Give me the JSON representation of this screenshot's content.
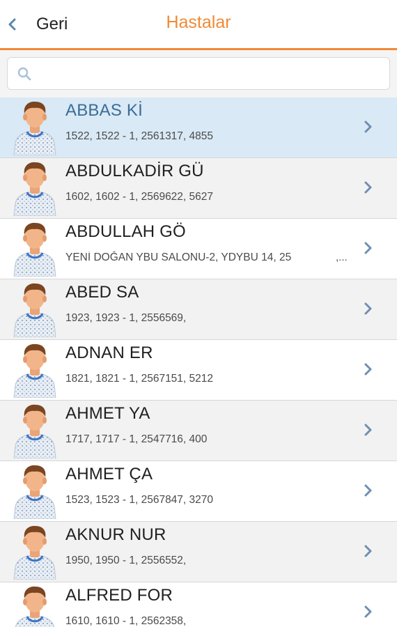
{
  "header": {
    "back_label": "Geri",
    "title": "Hastalar",
    "accent_color": "#f08a36"
  },
  "search": {
    "placeholder": "",
    "value": ""
  },
  "patients": [
    {
      "name": "ABBAS Kİ",
      "detail": "1522, 1522 - 1, 2561317, 4855",
      "extra": "",
      "selected": true
    },
    {
      "name": "ABDULKADİR GÜ",
      "detail": "1602, 1602 - 1, 2569622, 5627",
      "extra": "",
      "selected": false
    },
    {
      "name": "ABDULLAH GÖ",
      "detail": "YENİ DOĞAN YBU SALONU-2, YDYBU 14, 25",
      "extra": ",...",
      "selected": false
    },
    {
      "name": "ABED SA",
      "detail": "1923, 1923 - 1, 2556569,",
      "extra": "",
      "selected": false
    },
    {
      "name": "ADNAN ER",
      "detail": "1821, 1821 - 1, 2567151, 5212",
      "extra": "",
      "selected": false
    },
    {
      "name": "AHMET YA",
      "detail": "1717, 1717 - 1, 2547716, 400",
      "extra": "",
      "selected": false
    },
    {
      "name": "AHMET ÇA",
      "detail": "1523, 1523 - 1, 2567847, 3270",
      "extra": "",
      "selected": false
    },
    {
      "name": "AKNUR NUR",
      "detail": "1950, 1950 - 1, 2556552,",
      "extra": "",
      "selected": false
    },
    {
      "name": "ALFRED FOR",
      "detail": "1610, 1610 - 1, 2562358,",
      "extra": "",
      "selected": false
    }
  ],
  "icons": {
    "back": "chevron-left-icon",
    "search": "search-icon",
    "row_avatar": "patient-avatar-icon",
    "row_chevron": "chevron-right-icon"
  }
}
